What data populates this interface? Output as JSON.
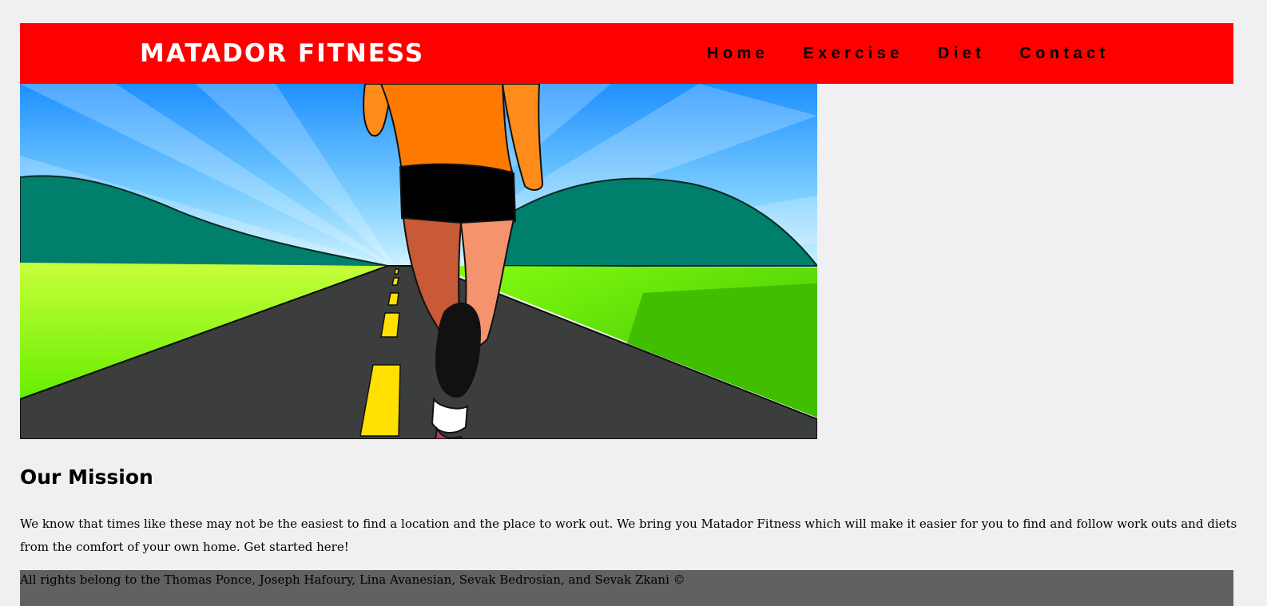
{
  "header": {
    "logo": "MATADOR FITNESS",
    "nav": [
      {
        "label": "Home"
      },
      {
        "label": "Exercise"
      },
      {
        "label": "Diet"
      },
      {
        "label": "Contact"
      }
    ]
  },
  "mission": {
    "title": "Our Mission",
    "text": "We know that times like these may not be the easiest to find a location and the place to work out. We bring you Matador Fitness which will make it easier for you to find and follow work outs and diets from the comfort of your own home. Get started here!"
  },
  "footer": {
    "text": "All rights belong to the Thomas Ponce, Joseph Hafoury, Lina Avanesian, Sevak Bedrosian, and Sevak Zkani ©"
  },
  "colors": {
    "navbar": "#ff0000",
    "background": "#f0f0f2",
    "footer": "#616160"
  }
}
